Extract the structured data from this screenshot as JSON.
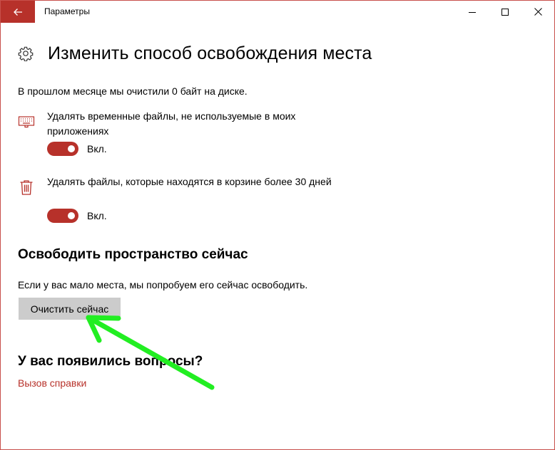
{
  "window": {
    "title": "Параметры"
  },
  "page": {
    "title": "Изменить способ освобождения места",
    "summary": "В прошлом месяце мы очистили 0 байт на диске."
  },
  "options": [
    {
      "text": "Удалять временные файлы, не используемые в моих приложениях",
      "toggle_label": "Вкл.",
      "on": true,
      "icon": "keyboard-icon"
    },
    {
      "text": "Удалять файлы, которые находятся в корзине более 30 дней",
      "toggle_label": "Вкл.",
      "on": true,
      "icon": "trash-icon"
    }
  ],
  "free_now": {
    "title": "Освободить пространство сейчас",
    "description": "Если у вас мало места, мы попробуем его сейчас освободить.",
    "button_label": "Очистить сейчас"
  },
  "help": {
    "title": "У вас появились вопросы?",
    "link_label": "Вызов справки"
  },
  "colors": {
    "accent": "#b7312a",
    "arrow": "#22ee22",
    "button_bg": "#cccccc"
  }
}
